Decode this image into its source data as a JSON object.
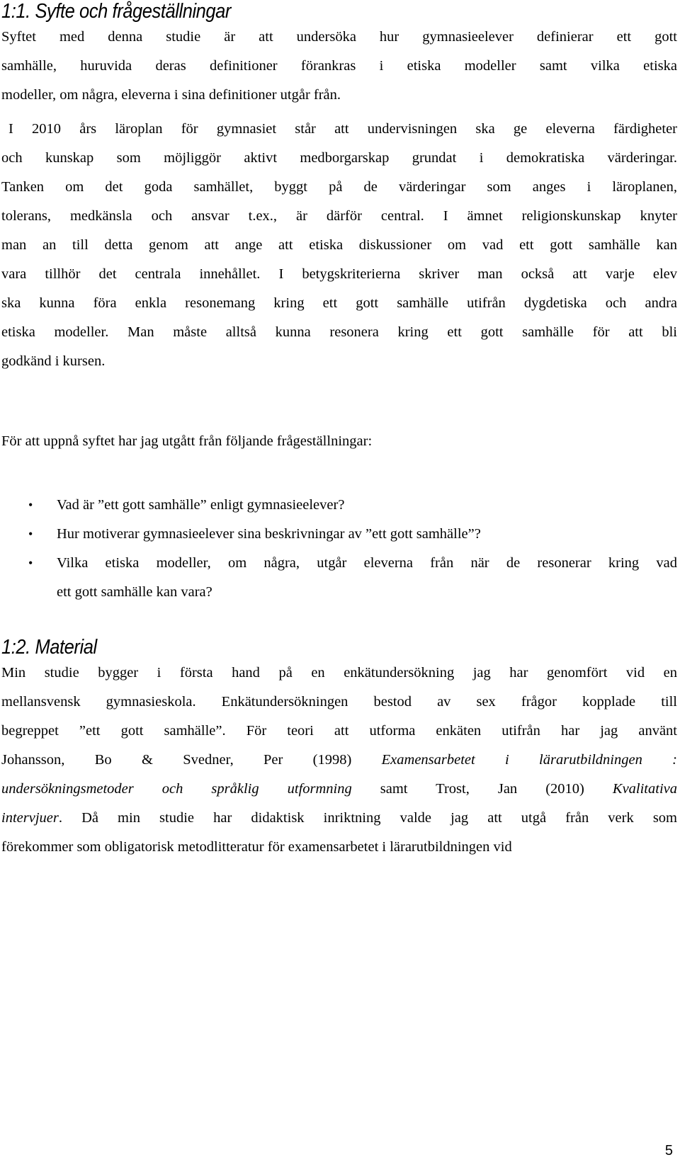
{
  "section1": {
    "heading": "1:1. Syfte och frågeställningar",
    "para1_lines": [
      "Syftet med denna studie är att undersöka hur gymnasieelever definierar ett gott",
      "samhälle, huruvida deras definitioner förankras i etiska modeller samt vilka etiska",
      "modeller, om några, eleverna i sina definitioner utgår från."
    ],
    "para2_lines": [
      "I 2010 års läroplan för gymnasiet står att undervisningen ska ge eleverna färdigheter",
      "och kunskap som möjliggör aktivt medborgarskap grundat i demokratiska värderingar.",
      "Tanken om det goda samhället, byggt på de värderingar som anges i läroplanen,",
      "tolerans, medkänsla och ansvar t.ex., är därför central. I ämnet religionskunskap knyter",
      "man an till detta genom att ange att etiska diskussioner om vad ett gott samhälle kan",
      "vara tillhör det centrala innehållet.  I betygskriterierna skriver man också att varje elev",
      "ska kunna föra enkla resonemang kring ett gott samhälle utifrån dygdetiska och andra",
      "etiska modeller. Man måste alltså kunna resonera kring ett gott samhälle för att bli",
      "godkänd i kursen."
    ],
    "questions_intro": "För att uppnå syftet har jag utgått från följande frågeställningar:",
    "bullet_glyph": "•",
    "questions": [
      {
        "line1": "Vad är ”ett gott samhälle” enligt gymnasieelever?",
        "line2": ""
      },
      {
        "line1": "Hur motiverar gymnasieelever sina beskrivningar av ”ett gott samhälle”?",
        "line2": ""
      },
      {
        "line1": "Vilka etiska modeller, om några, utgår eleverna från när de resonerar kring vad",
        "line2": "ett gott samhälle kan vara?"
      }
    ]
  },
  "section2": {
    "heading": "1:2. Material",
    "line1": "Min studie bygger i första hand på en enkätundersökning jag har genomfört vid en",
    "line2": "mellansvensk gymnasieskola. Enkätundersökningen bestod av sex frågor kopplade till",
    "line3": "begreppet ”ett gott samhälle”. För teori att utforma enkäten utifrån har jag använt",
    "line4_plain": "Johansson, Bo & Svedner, Per (1998) ",
    "line4_italic": "Examensarbetet i lärarutbildningen :",
    "line5_italic": "undersökningsmetoder och språklig utformning",
    "line5_plain": " samt Trost, Jan (2010) ",
    "line5_italic2": "Kvalitativa",
    "line6_italic": "intervjuer",
    "line6_plain": ". Då min studie har didaktisk inriktning valde jag att utgå från verk som",
    "line7": "förekommer som obligatorisk metodlitteratur för examensarbetet i lärarutbildningen vid"
  },
  "footer": {
    "page_number": "5"
  }
}
